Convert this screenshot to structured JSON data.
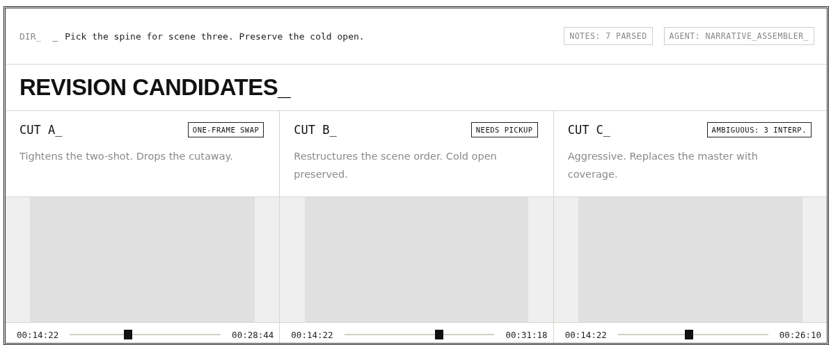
{
  "command_bar": {
    "prefix": "DIR_",
    "cursor": "_",
    "instruction": "Pick the spine for scene three. Preserve the cold open.",
    "chips": [
      "NOTES: 7 PARSED",
      "AGENT: NARRATIVE_ASSEMBLER_"
    ]
  },
  "heading": "REVISION CANDIDATES_",
  "cuts": [
    {
      "title": "CUT A_",
      "tag": "ONE-FRAME SWAP",
      "description": "Tightens the two-shot. Drops the cutaway.",
      "start": "00:14:22",
      "end": "00:28:44",
      "level": 0.38
    },
    {
      "title": "CUT B_",
      "tag": "NEEDS PICKUP",
      "description": "Restructures the scene order. Cold open preserved.",
      "start": "00:14:22",
      "end": "00:31:18",
      "level": 0.64
    },
    {
      "title": "CUT C_",
      "tag": "AMBIGUOUS: 3 INTERP.",
      "description": "Aggressive. Replaces the master with coverage.",
      "start": "00:14:22",
      "end": "00:26:10",
      "level": 0.47
    }
  ]
}
